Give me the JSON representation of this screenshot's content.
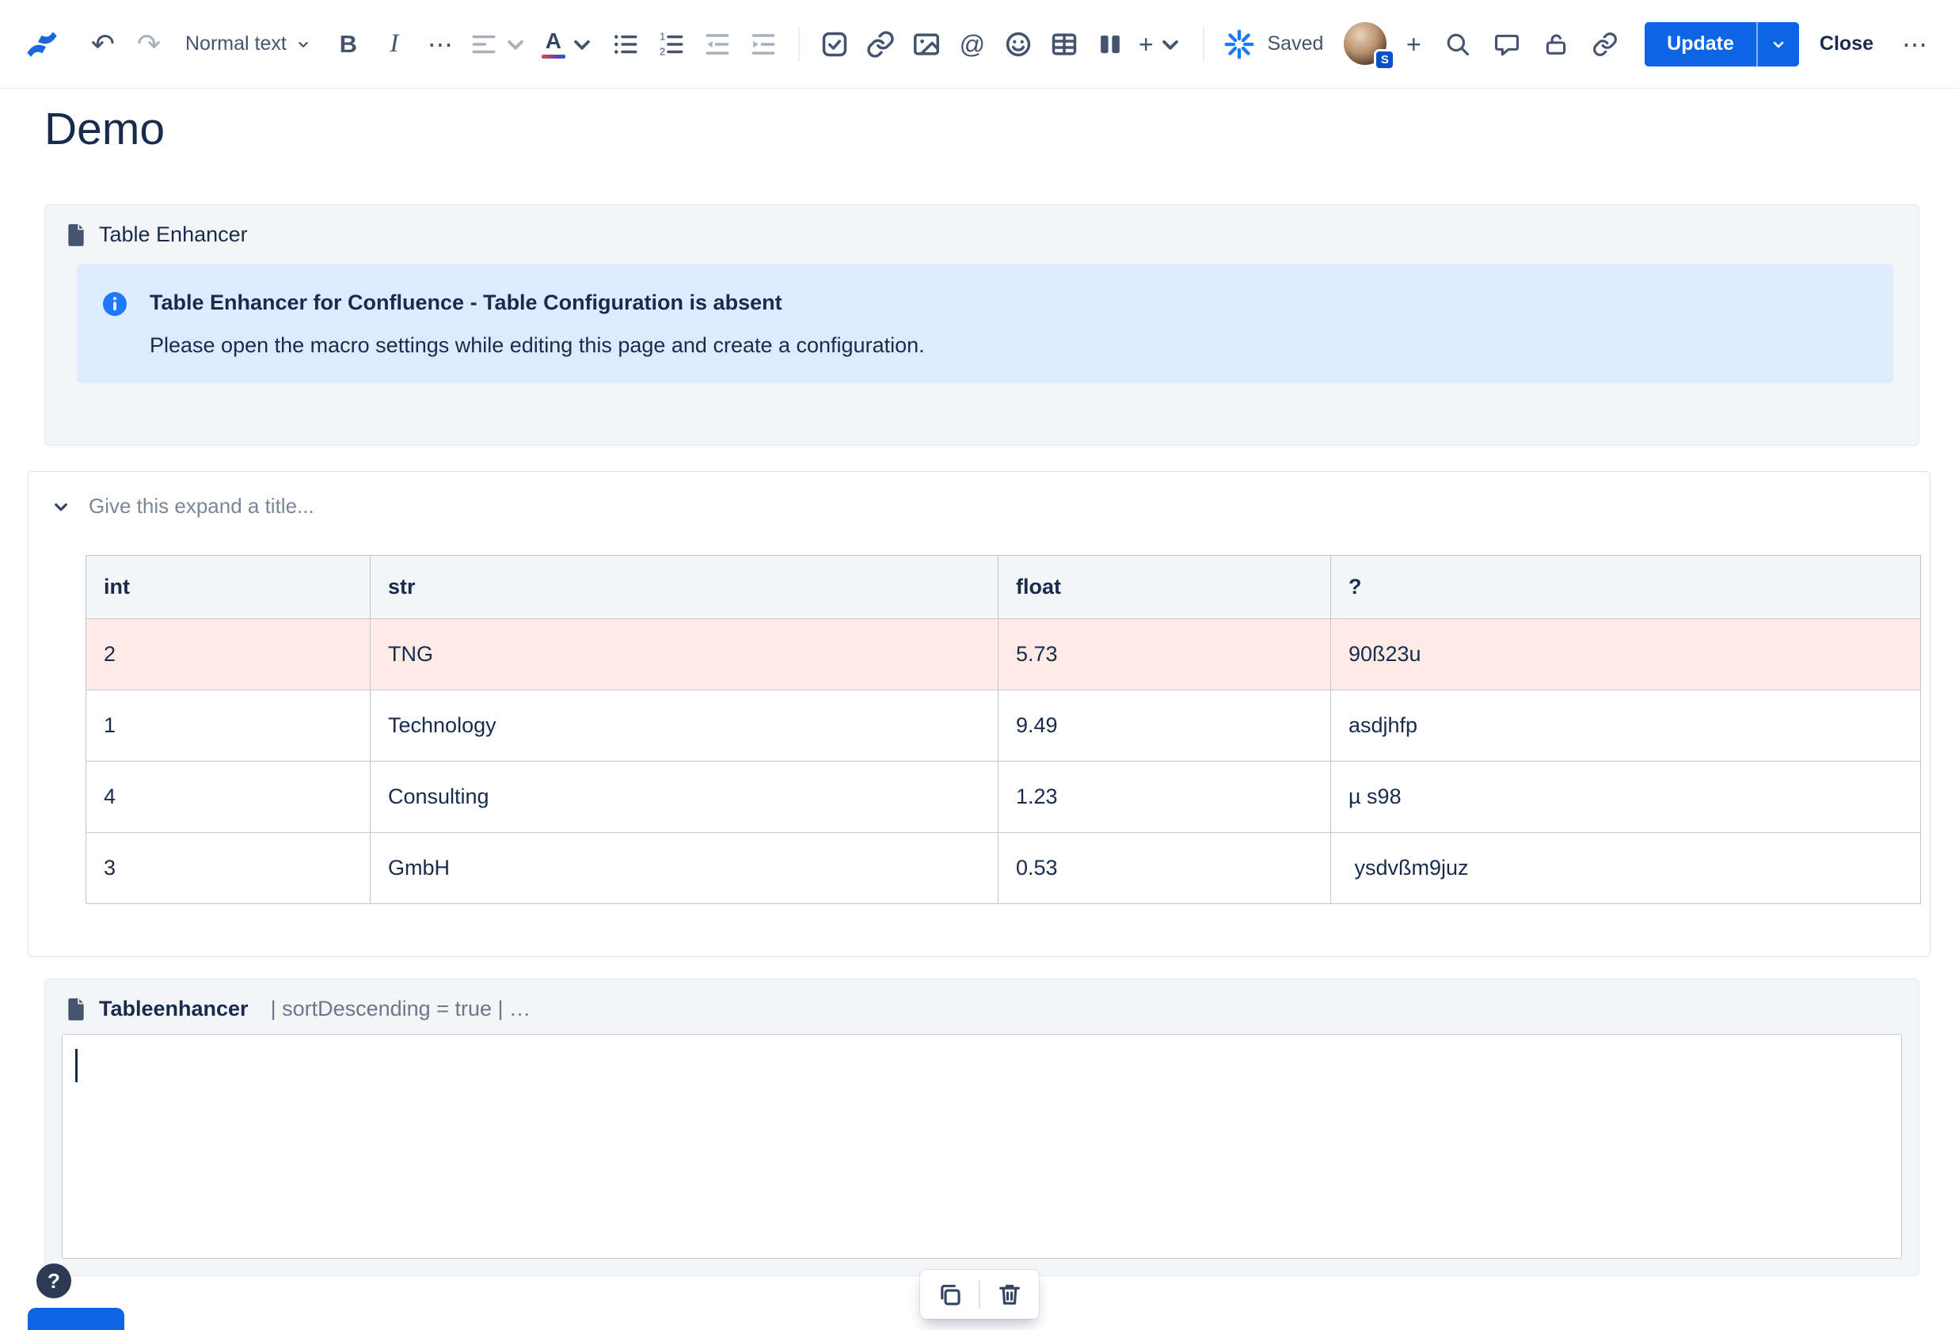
{
  "toolbar": {
    "text_style": "Normal text",
    "saved_label": "Saved",
    "update_label": "Update",
    "close_label": "Close",
    "avatar_badge": "S",
    "icons": {
      "undo": "↶",
      "redo": "↷",
      "bold": "B",
      "italic": "I",
      "more_formatting": "⋯",
      "text_color": "A",
      "mention": "@",
      "insert_plus": "+",
      "invite_plus": "+",
      "overflow": "⋯"
    }
  },
  "page": {
    "title": "Demo"
  },
  "table_enhancer_macro": {
    "name": "Table Enhancer",
    "info_panel": {
      "title": "Table Enhancer for Confluence - Table Configuration is absent",
      "body": "Please open the macro settings while editing this page and create a configuration."
    }
  },
  "expand": {
    "title_placeholder": "Give this expand a title...",
    "table": {
      "headers": [
        "int",
        "str",
        "float",
        "?"
      ],
      "rows": [
        [
          "2",
          "TNG",
          "5.73",
          "90ß23u"
        ],
        [
          "1",
          "Technology",
          "9.49",
          "asdjhfp"
        ],
        [
          "4",
          "Consulting",
          "1.23",
          "µ s98"
        ],
        [
          "3",
          "GmbH",
          "0.53",
          " ysdvßm9juz"
        ]
      ],
      "highlighted_row_index": 0,
      "highlight_color": "#FFEBE6"
    }
  },
  "tableenhancer_macro": {
    "name": "Tableenhancer",
    "params": "| sortDescending = true | …"
  },
  "help_button_label": "?",
  "colors": {
    "accent_blue": "#0C66E4",
    "brand_blue": "#1868DB",
    "info_panel_bg": "#DEEBFF",
    "macro_bg": "#F4F5F7",
    "highlight_row": "#FFEBE6"
  }
}
